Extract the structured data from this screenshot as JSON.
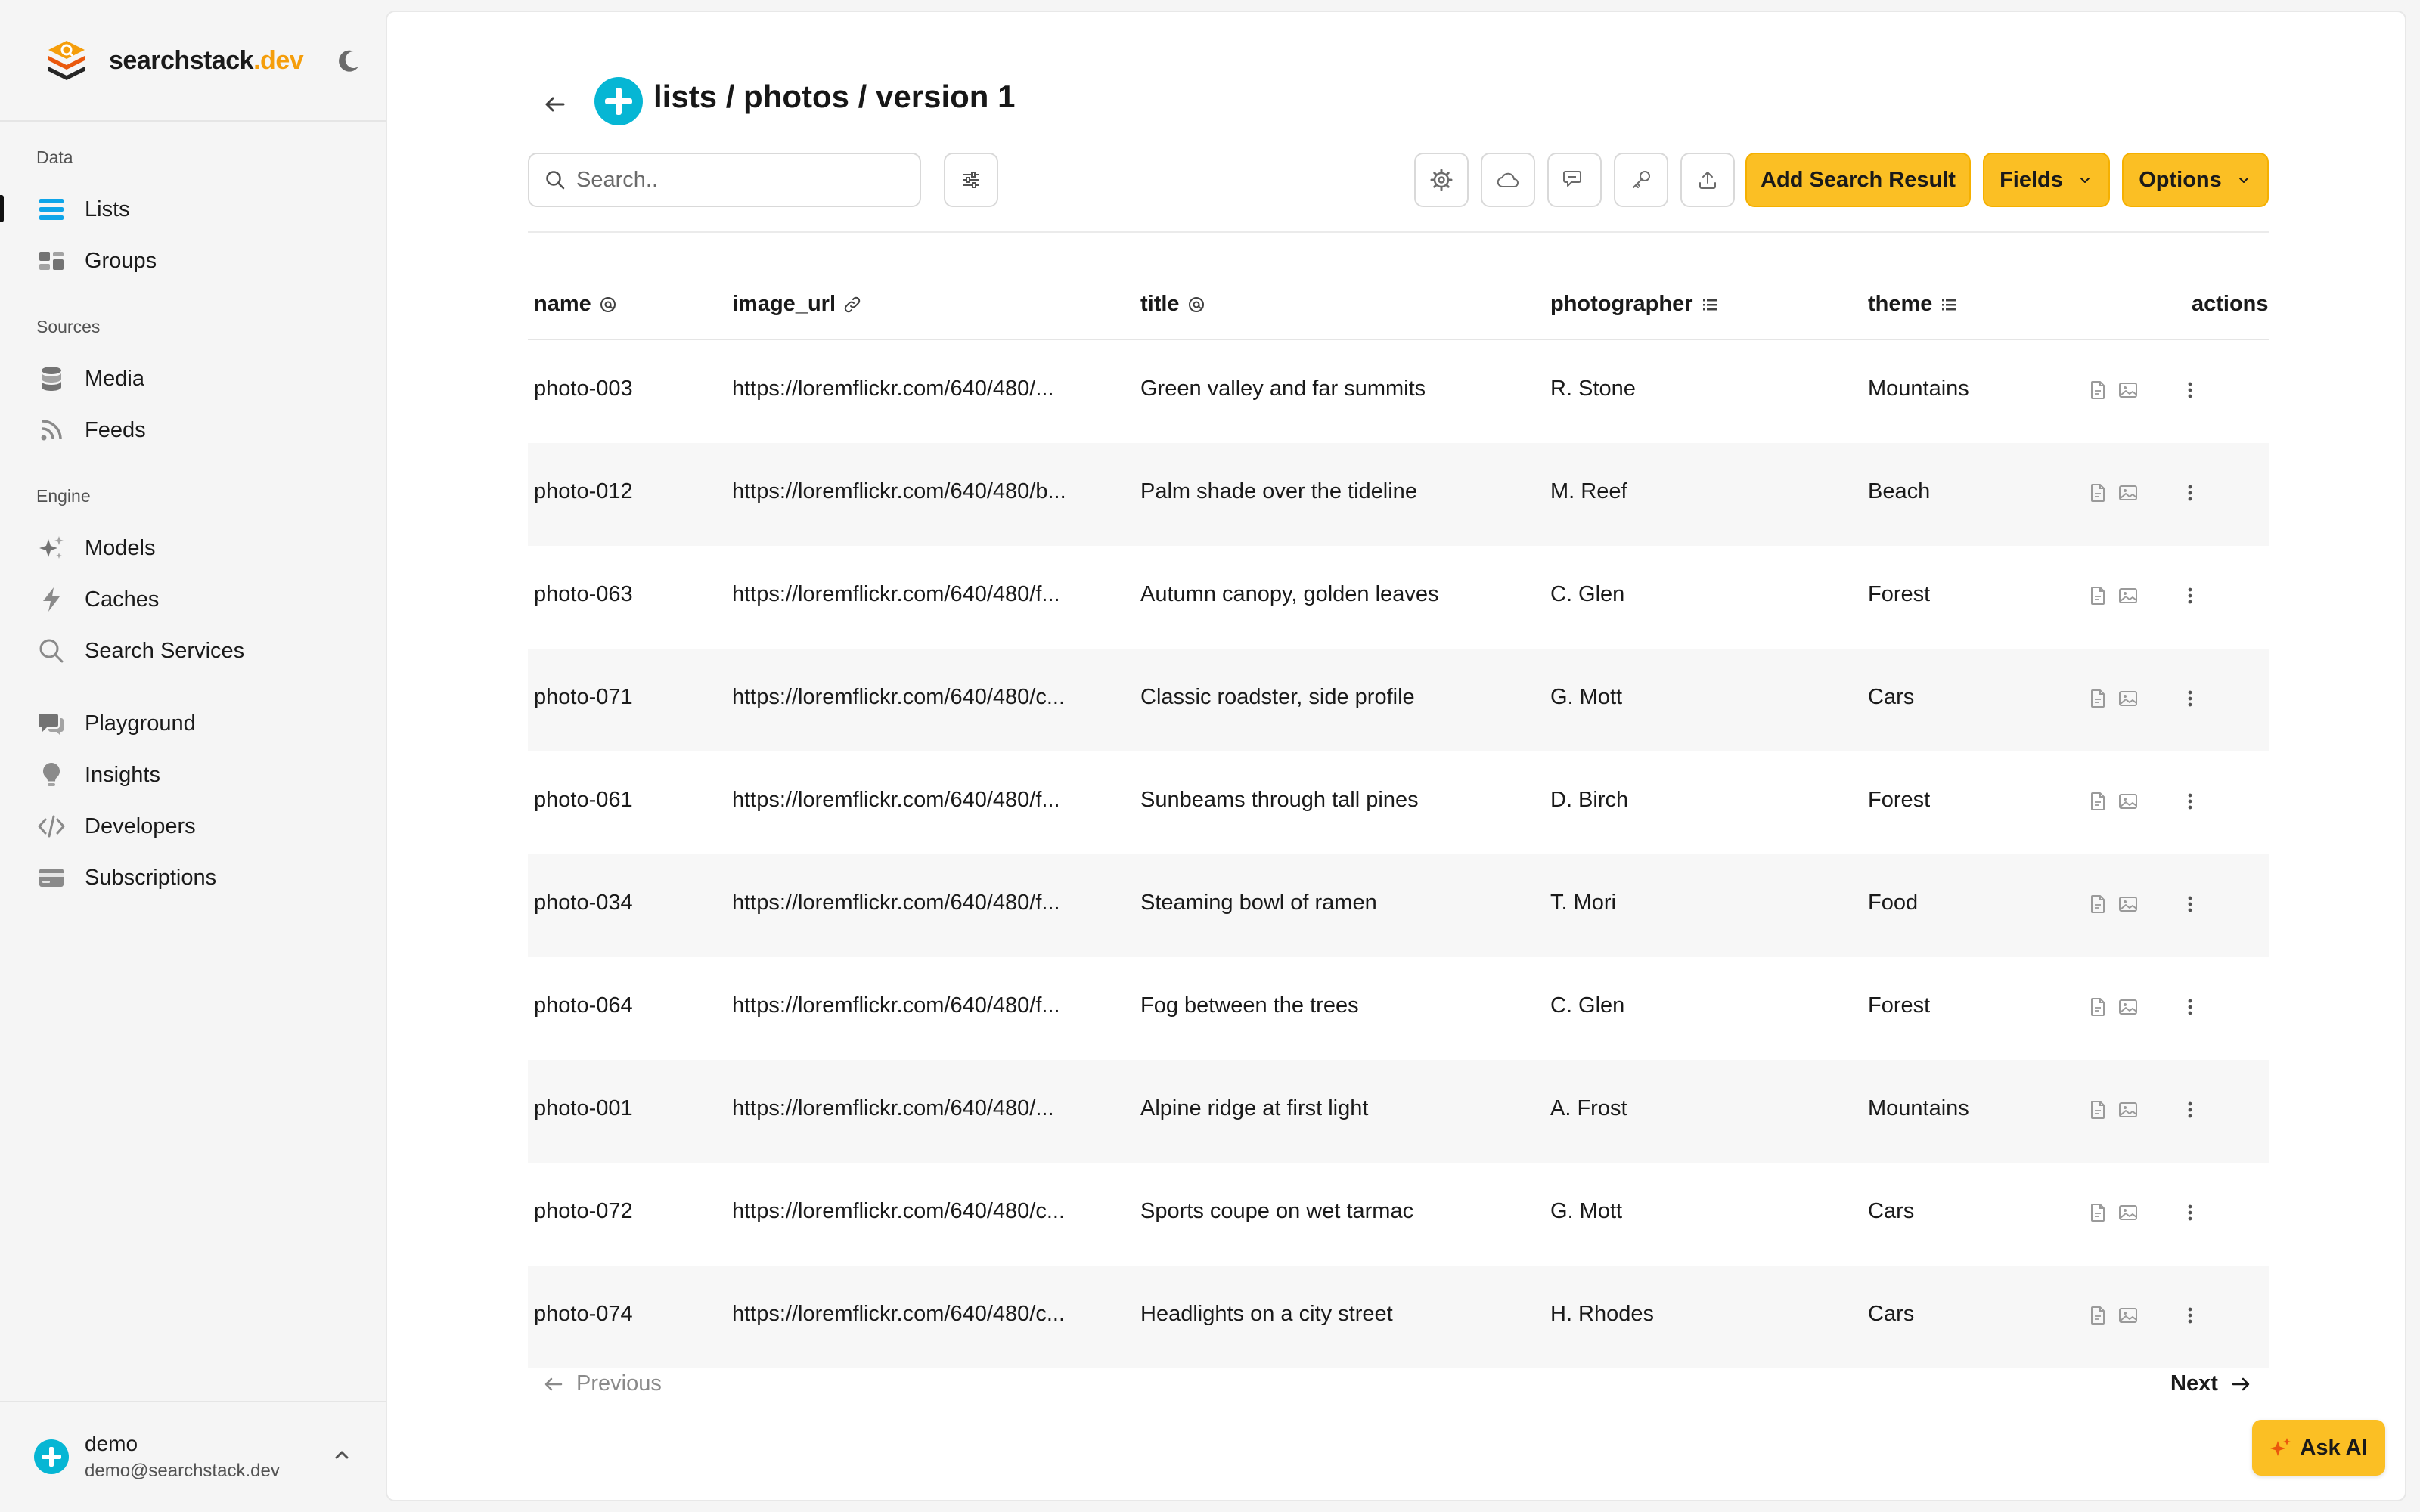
{
  "brand": {
    "name": "searchstack",
    "tld": ".dev",
    "accent": "#f59e0b"
  },
  "sidebar": {
    "sections": [
      {
        "label": "Data",
        "items": [
          {
            "label": "Lists",
            "icon": "list-icon",
            "active": true
          },
          {
            "label": "Groups",
            "icon": "groups-icon"
          }
        ]
      },
      {
        "label": "Sources",
        "items": [
          {
            "label": "Media",
            "icon": "database-icon"
          },
          {
            "label": "Feeds",
            "icon": "rss-icon"
          }
        ]
      },
      {
        "label": "Engine",
        "items": [
          {
            "label": "Models",
            "icon": "sparkles-icon"
          },
          {
            "label": "Caches",
            "icon": "bolt-icon"
          },
          {
            "label": "Search Services",
            "icon": "search-icon"
          }
        ]
      },
      {
        "label": "",
        "items": [
          {
            "label": "Playground",
            "icon": "chat-icon"
          },
          {
            "label": "Insights",
            "icon": "lightbulb-icon"
          },
          {
            "label": "Developers",
            "icon": "code-icon"
          },
          {
            "label": "Subscriptions",
            "icon": "credit-card-icon"
          }
        ]
      }
    ]
  },
  "user": {
    "name": "demo",
    "email": "demo@searchstack.dev"
  },
  "header": {
    "title": "lists / photos / version 1"
  },
  "toolbar": {
    "search_placeholder": "Search..",
    "add_label": "Add Search Result",
    "fields_label": "Fields",
    "options_label": "Options",
    "accent": "#fbbf24"
  },
  "table": {
    "columns": {
      "name": "name",
      "image_url": "image_url",
      "title": "title",
      "photographer": "photographer",
      "theme": "theme",
      "actions": "actions"
    },
    "rows": [
      {
        "name": "photo-003",
        "image_url": "https://loremflickr.com/640/480/...",
        "title": "Green valley and far summits",
        "photographer": "R. Stone",
        "theme": "Mountains"
      },
      {
        "name": "photo-012",
        "image_url": "https://loremflickr.com/640/480/b...",
        "title": "Palm shade over the tideline",
        "photographer": "M. Reef",
        "theme": "Beach"
      },
      {
        "name": "photo-063",
        "image_url": "https://loremflickr.com/640/480/f...",
        "title": "Autumn canopy, golden leaves",
        "photographer": "C. Glen",
        "theme": "Forest"
      },
      {
        "name": "photo-071",
        "image_url": "https://loremflickr.com/640/480/c...",
        "title": "Classic roadster, side profile",
        "photographer": "G. Mott",
        "theme": "Cars"
      },
      {
        "name": "photo-061",
        "image_url": "https://loremflickr.com/640/480/f...",
        "title": "Sunbeams through tall pines",
        "photographer": "D. Birch",
        "theme": "Forest"
      },
      {
        "name": "photo-034",
        "image_url": "https://loremflickr.com/640/480/f...",
        "title": "Steaming bowl of ramen",
        "photographer": "T. Mori",
        "theme": "Food"
      },
      {
        "name": "photo-064",
        "image_url": "https://loremflickr.com/640/480/f...",
        "title": "Fog between the trees",
        "photographer": "C. Glen",
        "theme": "Forest"
      },
      {
        "name": "photo-001",
        "image_url": "https://loremflickr.com/640/480/...",
        "title": "Alpine ridge at first light",
        "photographer": "A. Frost",
        "theme": "Mountains"
      },
      {
        "name": "photo-072",
        "image_url": "https://loremflickr.com/640/480/c...",
        "title": "Sports coupe on wet tarmac",
        "photographer": "G. Mott",
        "theme": "Cars"
      },
      {
        "name": "photo-074",
        "image_url": "https://loremflickr.com/640/480/c...",
        "title": "Headlights on a city street",
        "photographer": "H. Rhodes",
        "theme": "Cars"
      }
    ]
  },
  "pagination": {
    "previous_label": "Previous",
    "next_label": "Next"
  },
  "ask_ai": {
    "label": "Ask AI"
  }
}
